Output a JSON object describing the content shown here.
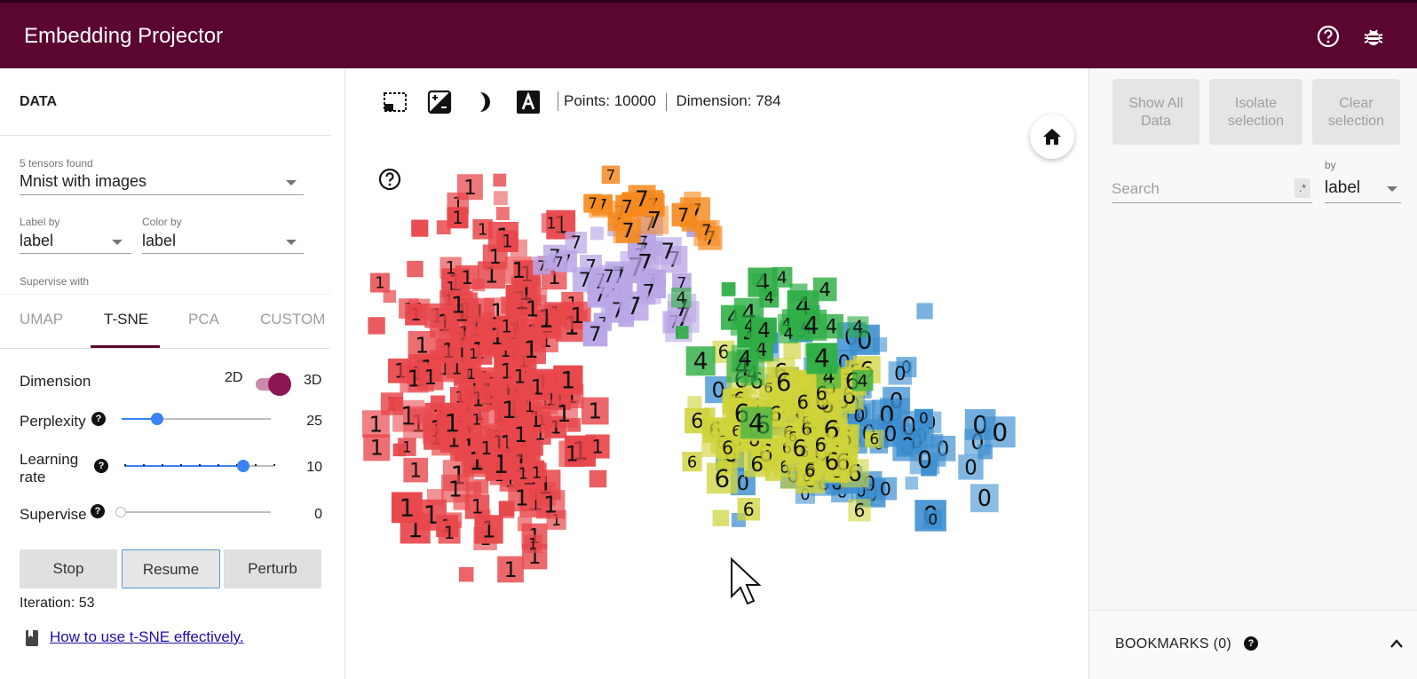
{
  "app": {
    "title": "Embedding Projector"
  },
  "topbar": {
    "help_icon": "help-circle-icon",
    "bug_icon": "bug-icon"
  },
  "data_panel": {
    "title": "DATA",
    "tensors_found": "5 tensors found",
    "tensor": "Mnist with images",
    "label_by_label": "Label by",
    "label_by_value": "label",
    "color_by_label": "Color by",
    "color_by_value": "label",
    "supervise_with_label": "Supervise with"
  },
  "tabs": [
    {
      "label": "UMAP",
      "active": false
    },
    {
      "label": "T-SNE",
      "active": true
    },
    {
      "label": "PCA",
      "active": false
    },
    {
      "label": "CUSTOM",
      "active": false
    }
  ],
  "tsne": {
    "dimension_label": "Dimension",
    "dim_2d": "2D",
    "dim_3d": "3D",
    "dimension_selected": "3D",
    "perplexity_label": "Perplexity",
    "perplexity_value": "25",
    "perplexity_fraction": 0.24,
    "learning_rate_label": "Learning rate",
    "learning_rate_line1": "Learning",
    "learning_rate_line2": "rate",
    "learning_rate_value": "10",
    "learning_rate_fraction": 0.8,
    "supervise_label": "Supervise",
    "supervise_value": "0",
    "supervise_fraction": 0.0,
    "stop_label": "Stop",
    "resume_label": "Resume",
    "perturb_label": "Perturb",
    "iteration_text": "Iteration: 53",
    "link_text": "How to use t-SNE effectively."
  },
  "toolbar": {
    "points_text": "Points: 10000",
    "dimension_text": "Dimension: 784"
  },
  "right_panel": {
    "show_all_line1": "Show All",
    "show_all_line2": "Data",
    "isolate_line1": "Isolate",
    "isolate_line2": "selection",
    "clear_line1": "Clear",
    "clear_line2": "selection",
    "search_placeholder": "Search",
    "regex_label": ".*",
    "by_label": "by",
    "by_value": "label",
    "bookmarks_title": "BOOKMARKS (0)"
  },
  "colors": {
    "header_bg": "#5b0630",
    "digit_0": "#3d8fd1",
    "digit_1": "#e8474b",
    "digit_4": "#2fae46",
    "digit_6": "#cfd33a",
    "digit_7": "#f58a1f",
    "digit_other": "#b9a6e6",
    "accent": "#3b82f6"
  }
}
